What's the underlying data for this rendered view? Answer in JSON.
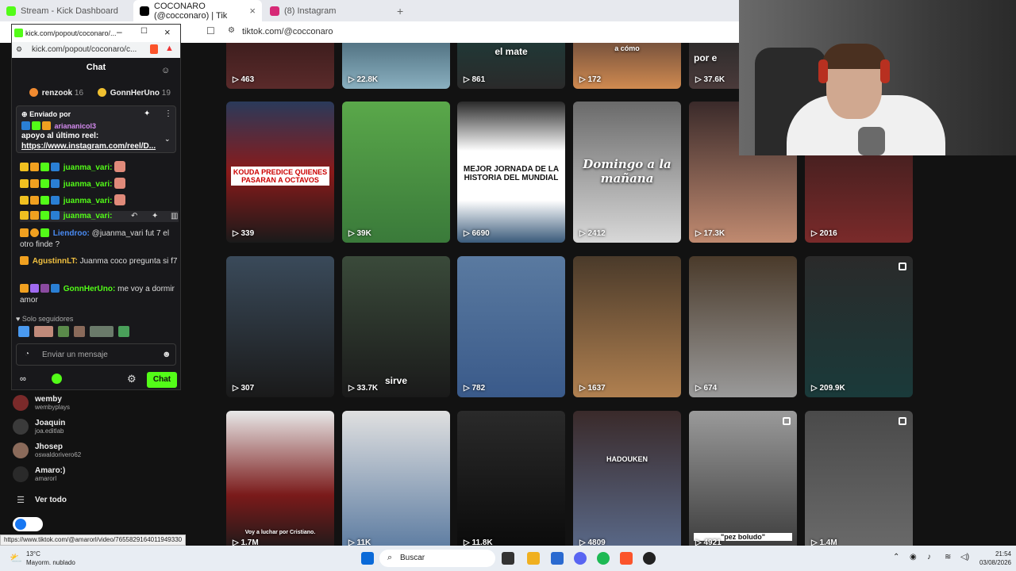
{
  "tabs": [
    {
      "title": "Stream - Kick Dashboard",
      "color": "#53fc18"
    },
    {
      "title": "COCONARO (@cocconaro) | Tik",
      "color": "#000000"
    },
    {
      "title": "(8) Instagram",
      "color": "#d62976"
    }
  ],
  "address": {
    "url": "tiktok.com/@cocconaro"
  },
  "popup": {
    "title_url": "kick.com/popout/coconaro/...",
    "address_url": "kick.com/popout/coconaro/c...",
    "header": "Chat",
    "top_gifters": [
      {
        "name": "renzook",
        "count": "16"
      },
      {
        "name": "GonnHerUno",
        "count": "19"
      }
    ],
    "pinned": {
      "label": "Enviado por",
      "user": "ariananicol3",
      "text": "apoyo al último reel:",
      "link": "https://www.instagram.com/reel/D..."
    },
    "messages": [
      {
        "user": "juanma_vari:",
        "text": ""
      },
      {
        "user": "juanma_vari:",
        "text": ""
      },
      {
        "user": "juanma_vari:",
        "text": ""
      },
      {
        "user": "juanma_vari:",
        "text": ""
      },
      {
        "user": "Liendroo:",
        "text": "@juanma_vari fut 7 el otro finde ?"
      },
      {
        "user": "AgustinnLT:",
        "text": "Juanma coco pregunta si f7"
      },
      {
        "user": "GonnHerUno:",
        "text": "me voy a dormir amor"
      }
    ],
    "followers_only": "Solo seguidores",
    "input_placeholder": "Enviar un mensaje",
    "chat_button": "Chat"
  },
  "sidebar": {
    "users": [
      {
        "name": "wemby",
        "handle": "wembyplays"
      },
      {
        "name": "Joaquin",
        "handle": "joa.editlab"
      },
      {
        "name": "Jhosep",
        "handle": "oswaldorivero62"
      },
      {
        "name": "Amaro:)",
        "handle": "amarorl"
      }
    ],
    "see_all": "Ver todo"
  },
  "videos": {
    "row0": [
      {
        "count": "463",
        "caption": ""
      },
      {
        "count": "22.8K",
        "caption": ""
      },
      {
        "count": "861",
        "caption": "el mate"
      },
      {
        "count": "172",
        "caption": "a cómo"
      },
      {
        "count": "37.6K",
        "caption": "por e"
      }
    ],
    "row1": [
      {
        "count": "339",
        "caption": "KOUDA PREDICE QUIENES PASARAN A OCTAVOS"
      },
      {
        "count": "39K",
        "caption": ""
      },
      {
        "count": "6690",
        "caption": "MEJOR JORNADA DE LA HISTORIA DEL MUNDIAL"
      },
      {
        "count": "2412",
        "caption": "Domingo a la mañana"
      },
      {
        "count": "17.3K",
        "caption": ""
      },
      {
        "count": "2016",
        "caption": ""
      }
    ],
    "row2": [
      {
        "count": "307",
        "caption": ""
      },
      {
        "count": "33.7K",
        "caption": "sirve"
      },
      {
        "count": "782",
        "caption": ""
      },
      {
        "count": "1637",
        "caption": ""
      },
      {
        "count": "674",
        "caption": ""
      },
      {
        "count": "209.9K",
        "caption": ""
      }
    ],
    "row3": [
      {
        "count": "1.7M",
        "caption": "Voy a luchar por Cristiano."
      },
      {
        "count": "11K",
        "caption": ""
      },
      {
        "count": "11.8K",
        "caption": ""
      },
      {
        "count": "4809",
        "caption": "HADOUKEN"
      },
      {
        "count": "4921",
        "caption": "\"pez boludo\""
      },
      {
        "count": "1.4M",
        "caption": ""
      }
    ]
  },
  "status_url": "https://www.tiktok.com/@amarorl/video/7655829164011949330",
  "taskbar": {
    "weather_temp": "13°C",
    "weather_desc": "Mayorm. nublado",
    "search_label": "Buscar",
    "time": "21:54",
    "date": "03/08/2026"
  }
}
